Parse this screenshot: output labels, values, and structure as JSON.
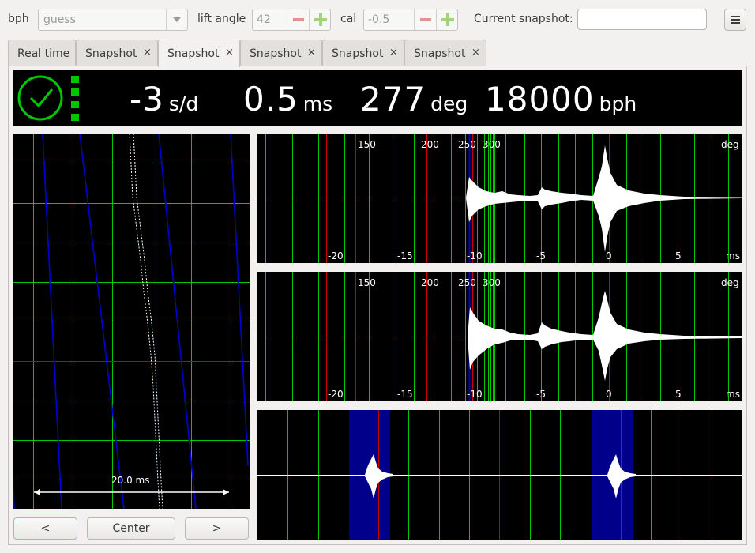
{
  "toolbar": {
    "bph_label": "bph",
    "bph_value": "guess",
    "lift_angle_label": "lift angle",
    "lift_angle_value": "42",
    "cal_label": "cal",
    "cal_value": "-0.5",
    "snapshot_label": "Current snapshot:",
    "snapshot_value": ""
  },
  "tabs": [
    {
      "label": "Real time",
      "closable": false,
      "active": false
    },
    {
      "label": "Snapshot",
      "closable": true,
      "active": false
    },
    {
      "label": "Snapshot",
      "closable": true,
      "active": true
    },
    {
      "label": "Snapshot",
      "closable": true,
      "active": false
    },
    {
      "label": "Snapshot",
      "closable": true,
      "active": false
    },
    {
      "label": "Snapshot",
      "closable": true,
      "active": false
    }
  ],
  "close_glyph": "×",
  "readouts": {
    "rate_value": "-3",
    "rate_unit": "s/d",
    "beat_error_value": "0.5",
    "beat_error_unit": "ms",
    "amplitude_value": "277",
    "amplitude_unit": "deg",
    "bph_value": "18000",
    "bph_unit": "bph"
  },
  "status": {
    "icon": "clock-ok-icon",
    "color": "#00c800"
  },
  "paperstrip": {
    "scale_label": "20.0 ms"
  },
  "waveforms": {
    "deg_ticks": [
      "150",
      "200",
      "250",
      "300"
    ],
    "deg_unit": "deg",
    "ms_ticks": [
      "-20",
      "-15",
      "-10",
      "-5",
      "0",
      "5"
    ],
    "ms_unit": "ms"
  },
  "buttons": {
    "prev": "<",
    "center": "Center",
    "next": ">"
  },
  "colors": {
    "grid_green": "#00c800",
    "grid_red": "#c80000",
    "trace_blue": "#0000d0",
    "period_band": "#00008a"
  }
}
